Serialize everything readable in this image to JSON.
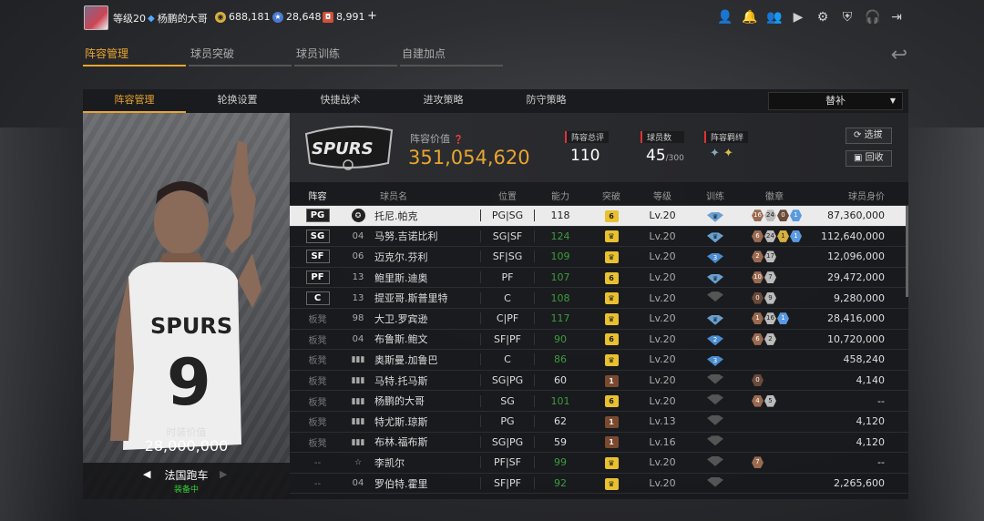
{
  "topbar": {
    "level": "等级20",
    "username": "杨鹏的大哥",
    "gold": "688,181",
    "points": "28,648",
    "tickets": "8,991",
    "add": "+"
  },
  "main_tabs": [
    "阵容管理",
    "球员突破",
    "球员训练",
    "自建加点"
  ],
  "sub_tabs": [
    "阵容管理",
    "轮换设置",
    "快捷战术",
    "进攻策略",
    "防守策略"
  ],
  "dropdown": {
    "selected": "替补"
  },
  "card": {
    "value_label": "时装价值",
    "value": "28,000,000",
    "car_name": "法国跑车",
    "car_status": "装备中"
  },
  "team": {
    "value_label": "阵容价值",
    "value": "351,054,620",
    "rating_label": "阵容总评",
    "rating": "110",
    "count_label": "球员数",
    "count": "45",
    "count_max": "/300",
    "bond_label": "阵容羁绊",
    "btn_select": "选拔",
    "btn_recycle": "回收"
  },
  "columns": [
    "阵容",
    "球员名",
    "位置",
    "能力",
    "突破",
    "等级",
    "训练",
    "徽章",
    "球员身价"
  ],
  "rows": [
    {
      "pos": "PG",
      "tag": true,
      "num": "",
      "name": "托尼.帕克",
      "p2": "PG|SG",
      "ab": "118",
      "green": false,
      "brk": "6",
      "lv": "Lv.20",
      "tr": "",
      "badges": [
        [
          "16",
          "br"
        ],
        [
          "24",
          "si"
        ],
        [
          "0",
          "dk"
        ],
        [
          "1",
          "pl"
        ]
      ],
      "val": "87,360,000",
      "sel": true
    },
    {
      "pos": "SG",
      "tag": true,
      "num": "04",
      "name": "马努.吉诺比利",
      "p2": "SG|SF",
      "ab": "124",
      "green": true,
      "brk": "",
      "lv": "Lv.20",
      "tr": "",
      "badges": [
        [
          "6",
          "br"
        ],
        [
          "24",
          "si"
        ],
        [
          "1",
          "go"
        ],
        [
          "1",
          "pl"
        ]
      ],
      "val": "112,640,000"
    },
    {
      "pos": "SF",
      "tag": true,
      "num": "06",
      "name": "迈克尔.芬利",
      "p2": "SF|SG",
      "ab": "109",
      "green": true,
      "brk": "",
      "lv": "Lv.20",
      "tr": "3",
      "badges": [
        [
          "2",
          "br"
        ],
        [
          "17",
          "si"
        ]
      ],
      "val": "12,096,000"
    },
    {
      "pos": "PF",
      "tag": true,
      "num": "13",
      "name": "鲍里斯.迪奥",
      "p2": "PF",
      "ab": "107",
      "green": true,
      "brk": "6",
      "lv": "Lv.20",
      "tr": "",
      "badges": [
        [
          "10",
          "br"
        ],
        [
          "7",
          "si"
        ]
      ],
      "val": "29,472,000"
    },
    {
      "pos": "C",
      "tag": true,
      "num": "13",
      "name": "提亚哥.斯普里特",
      "p2": "C",
      "ab": "108",
      "green": true,
      "brk": "",
      "lv": "Lv.20",
      "tr": "g",
      "badges": [
        [
          "0",
          "dk"
        ],
        [
          "9",
          "si"
        ]
      ],
      "val": "9,280,000"
    },
    {
      "pos": "板凳",
      "tag": false,
      "num": "98",
      "name": "大卫.罗宾逊",
      "p2": "C|PF",
      "ab": "117",
      "green": true,
      "brk": "",
      "lv": "Lv.20",
      "tr": "",
      "badges": [
        [
          "1",
          "br"
        ],
        [
          "16",
          "si"
        ],
        [
          "1",
          "pl"
        ]
      ],
      "val": "28,416,000"
    },
    {
      "pos": "板凳",
      "tag": false,
      "num": "04",
      "name": "布鲁斯.鲍文",
      "p2": "SF|PF",
      "ab": "90",
      "green": true,
      "brk": "6",
      "lv": "Lv.20",
      "tr": "2",
      "badges": [
        [
          "6",
          "br"
        ],
        [
          "2",
          "si"
        ]
      ],
      "val": "10,720,000"
    },
    {
      "pos": "板凳",
      "tag": false,
      "num": "bars",
      "name": "奥斯曼.加鲁巴",
      "p2": "C",
      "ab": "86",
      "green": true,
      "brk": "",
      "lv": "Lv.20",
      "tr": "3",
      "badges": [],
      "val": "458,240"
    },
    {
      "pos": "板凳",
      "tag": false,
      "num": "bars",
      "name": "马特.托马斯",
      "p2": "SG|PG",
      "ab": "60",
      "green": false,
      "brk": "1",
      "lv": "Lv.20",
      "tr": "g",
      "badges": [
        [
          "0",
          "dk"
        ]
      ],
      "val": "4,140"
    },
    {
      "pos": "板凳",
      "tag": false,
      "num": "bars",
      "name": "杨鹏的大哥",
      "p2": "SG",
      "ab": "101",
      "green": true,
      "brk": "6",
      "lv": "Lv.20",
      "tr": "g",
      "badges": [
        [
          "4",
          "br"
        ],
        [
          "5",
          "si"
        ]
      ],
      "val": "--"
    },
    {
      "pos": "板凳",
      "tag": false,
      "num": "bars",
      "name": "特尤斯.琼斯",
      "p2": "PG",
      "ab": "62",
      "green": false,
      "brk": "1",
      "lv": "Lv.13",
      "tr": "g",
      "badges": [],
      "val": "4,120"
    },
    {
      "pos": "板凳",
      "tag": false,
      "num": "bars",
      "name": "布林.福布斯",
      "p2": "SG|PG",
      "ab": "59",
      "green": false,
      "brk": "1",
      "lv": "Lv.16",
      "tr": "g",
      "badges": [],
      "val": "4,120"
    },
    {
      "pos": "--",
      "tag": false,
      "num": "star",
      "name": "李凯尔",
      "p2": "PF|SF",
      "ab": "99",
      "green": true,
      "brk": "",
      "lv": "Lv.20",
      "tr": "g",
      "badges": [
        [
          "7",
          "br"
        ]
      ],
      "val": "--"
    },
    {
      "pos": "--",
      "tag": false,
      "num": "04",
      "name": "罗伯特.霍里",
      "p2": "SF|PF",
      "ab": "92",
      "green": true,
      "brk": "",
      "lv": "Lv.20",
      "tr": "g",
      "badges": [],
      "val": "2,265,600"
    }
  ]
}
